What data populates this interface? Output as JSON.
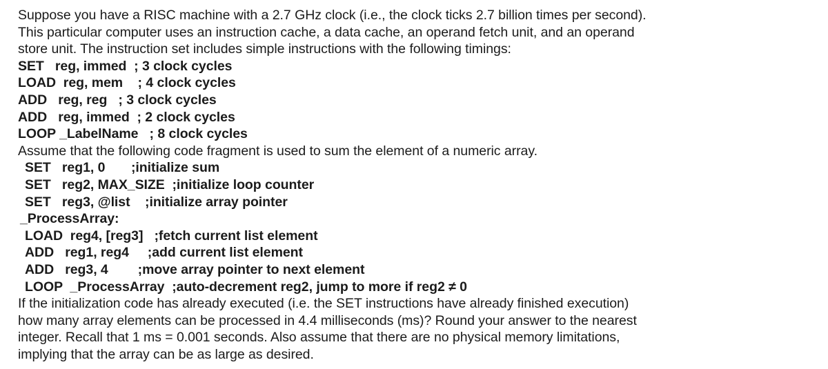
{
  "document": {
    "intro_paragraph": [
      "Suppose you have a RISC machine with a 2.7 GHz clock (i.e., the clock ticks 2.7 billion times per second).",
      "This particular computer uses an instruction cache, a data cache, an operand fetch unit, and an operand",
      "store unit. The instruction set includes simple instructions with the following timings:"
    ],
    "instruction_timings": [
      "SET   reg, immed  ; 3 clock cycles",
      "LOAD  reg, mem    ; 4 clock cycles",
      "ADD   reg, reg   ; 3 clock cycles",
      "ADD   reg, immed  ; 2 clock cycles",
      "LOOP _LabelName   ; 8 clock cycles"
    ],
    "assume_line": "Assume that the following code fragment is used to sum the element of a numeric array.",
    "code_fragment": [
      {
        "text": "SET   reg1, 0       ;initialize sum",
        "indent": "code-indent-1"
      },
      {
        "text": "SET   reg2, MAX_SIZE  ;initialize loop counter",
        "indent": "code-indent-1"
      },
      {
        "text": "SET   reg3, @list    ;initialize array pointer",
        "indent": "code-indent-1"
      },
      {
        "text": "_ProcessArray:",
        "indent": "code-indent-label"
      },
      {
        "text": "LOAD  reg4, [reg3]   ;fetch current list element",
        "indent": "code-indent-1"
      },
      {
        "text": "ADD   reg1, reg4     ;add current list element",
        "indent": "code-indent-1"
      },
      {
        "text": "ADD   reg3, 4        ;move array pointer to next element",
        "indent": "code-indent-1"
      },
      {
        "text": "LOOP  _ProcessArray  ;auto-decrement reg2, jump to more if reg2 ≠ 0",
        "indent": "code-indent-1"
      }
    ],
    "question_paragraph": [
      "If the initialization code has already executed (i.e. the SET instructions have already finished execution)",
      "how many array elements can be processed in 4.4 milliseconds (ms)? Round your answer to the nearest",
      "integer. Recall that 1 ms = 0.001 seconds. Also assume that there are no physical memory limitations,",
      "implying that the array can be as large as desired."
    ]
  }
}
